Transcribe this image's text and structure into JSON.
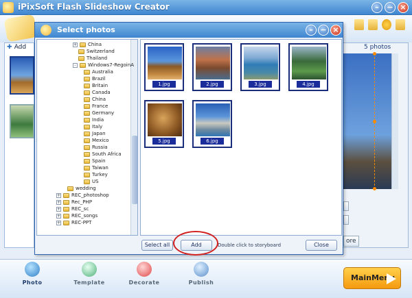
{
  "app": {
    "title": "iPixSoft Flash Slideshow Creator"
  },
  "storyboard": {
    "add_label": "Add",
    "photo_count": "5 photos"
  },
  "dialog": {
    "title": "Select photos",
    "tree": {
      "items": [
        {
          "label": "China",
          "expander": "+"
        },
        {
          "label": "Switzerland",
          "expander": ""
        },
        {
          "label": "Thailand",
          "expander": ""
        },
        {
          "label": "Windows7-RegoinA",
          "expander": "-"
        },
        {
          "label": "Australia",
          "expander": ""
        },
        {
          "label": "Brazil",
          "expander": ""
        },
        {
          "label": "Britain",
          "expander": ""
        },
        {
          "label": "Canada",
          "expander": ""
        },
        {
          "label": "China",
          "expander": ""
        },
        {
          "label": "France",
          "expander": ""
        },
        {
          "label": "Germany",
          "expander": ""
        },
        {
          "label": "India",
          "expander": ""
        },
        {
          "label": "Italy",
          "expander": ""
        },
        {
          "label": "Japan",
          "expander": ""
        },
        {
          "label": "Mexico",
          "expander": ""
        },
        {
          "label": "Russia",
          "expander": ""
        },
        {
          "label": "South Africa",
          "expander": ""
        },
        {
          "label": "Spain",
          "expander": ""
        },
        {
          "label": "Taiwan",
          "expander": ""
        },
        {
          "label": "Turkey",
          "expander": ""
        },
        {
          "label": "US",
          "expander": ""
        },
        {
          "label": "wedding",
          "expander": ""
        },
        {
          "label": "REC_photoshop",
          "expander": "+"
        },
        {
          "label": "Rec_PHP",
          "expander": "+"
        },
        {
          "label": "REC_sc",
          "expander": "+"
        },
        {
          "label": "REC_songs",
          "expander": "+"
        },
        {
          "label": "REC-PPT",
          "expander": "+"
        }
      ]
    },
    "photos": [
      {
        "caption": "1.jpg"
      },
      {
        "caption": "2.jpg"
      },
      {
        "caption": "3.jpg"
      },
      {
        "caption": "4.jpg"
      },
      {
        "caption": "5.jpg"
      },
      {
        "caption": "6.jpg"
      }
    ],
    "buttons": {
      "select_all": "Select all",
      "add": "Add",
      "close": "Close"
    },
    "hint": "Double click to storyboard"
  },
  "right_panel": {
    "more_label": "ore"
  },
  "bottom_nav": {
    "photo": "Photo",
    "template": "Template",
    "decorate": "Decorate",
    "publish": "Publish",
    "main_menu": "MainMenu"
  },
  "colors": {
    "accent": "#3f86d0",
    "highlight_ring": "#d22020",
    "main_menu": "#f59a10"
  }
}
